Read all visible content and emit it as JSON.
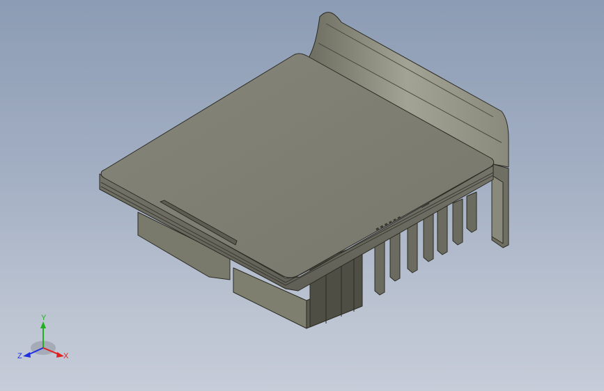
{
  "viewport": {
    "background_top": "#8c9cb4",
    "background_bottom": "#c6ccd8",
    "model_fill": "#7e7e6e",
    "model_edge": "#2a2a22"
  },
  "triad": {
    "x_label": "X",
    "y_label": "Y",
    "z_label": "Z",
    "x_color": "#e02020",
    "y_color": "#20b020",
    "z_color": "#2030e0"
  }
}
